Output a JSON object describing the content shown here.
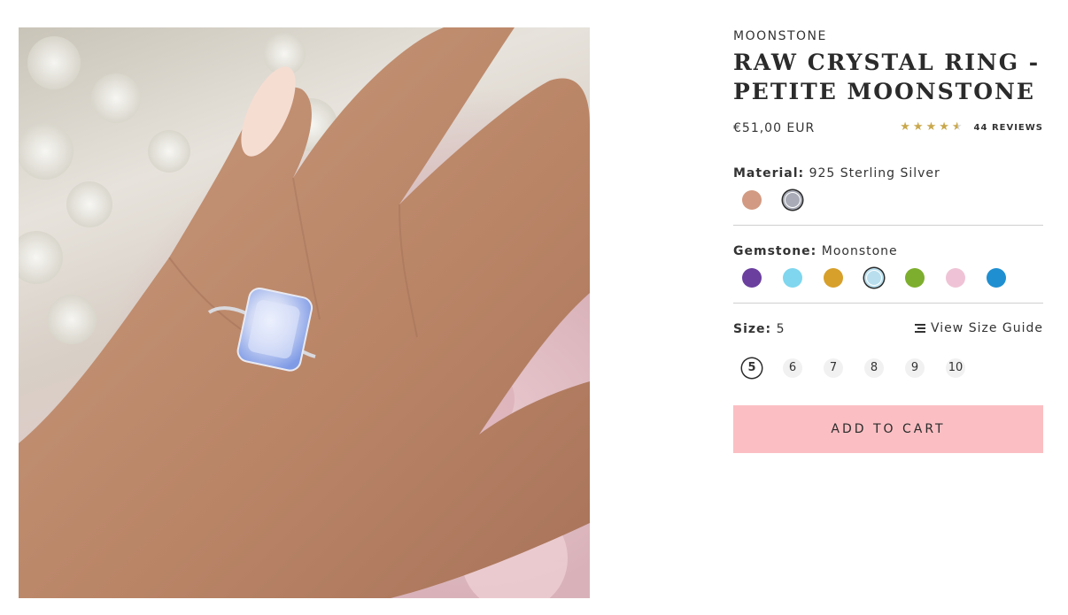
{
  "product": {
    "image_alt": "",
    "brand": "MOONSTONE",
    "title": "RAW CRYSTAL RING - PETITE MOONSTONE",
    "price": "€51,00 EUR",
    "rating": {
      "value": 4.5,
      "max": 5,
      "reviews_label": "44 REVIEWS",
      "star_color": "#c9a84c"
    }
  },
  "material": {
    "label": "Material:",
    "value": "925 Sterling Silver",
    "options": [
      {
        "name": "rose-gold",
        "color": "#d29a82",
        "selected": false
      },
      {
        "name": "sterling-silver",
        "color": "#a9acb6",
        "selected": true
      }
    ]
  },
  "gemstone": {
    "label": "Gemstone:",
    "value": "Moonstone",
    "options": [
      {
        "name": "amethyst",
        "color": "#6a3f9e",
        "selected": false
      },
      {
        "name": "aquamarine",
        "color": "#7fd6ee",
        "selected": false
      },
      {
        "name": "citrine",
        "color": "#d7a02b",
        "selected": false
      },
      {
        "name": "moonstone",
        "color": "#b9dfee",
        "selected": true
      },
      {
        "name": "peridot",
        "color": "#7dae2e",
        "selected": false
      },
      {
        "name": "rose-quartz",
        "color": "#efc3d5",
        "selected": false
      },
      {
        "name": "blue-topaz",
        "color": "#1f8fd1",
        "selected": false
      }
    ]
  },
  "size": {
    "label": "Size:",
    "value": "5",
    "guide_label": "View Size Guide",
    "options": [
      "5",
      "6",
      "7",
      "8",
      "9",
      "10"
    ],
    "selected": "5"
  },
  "cart": {
    "button_label": "ADD TO CART",
    "button_color": "#fbbfc3"
  }
}
